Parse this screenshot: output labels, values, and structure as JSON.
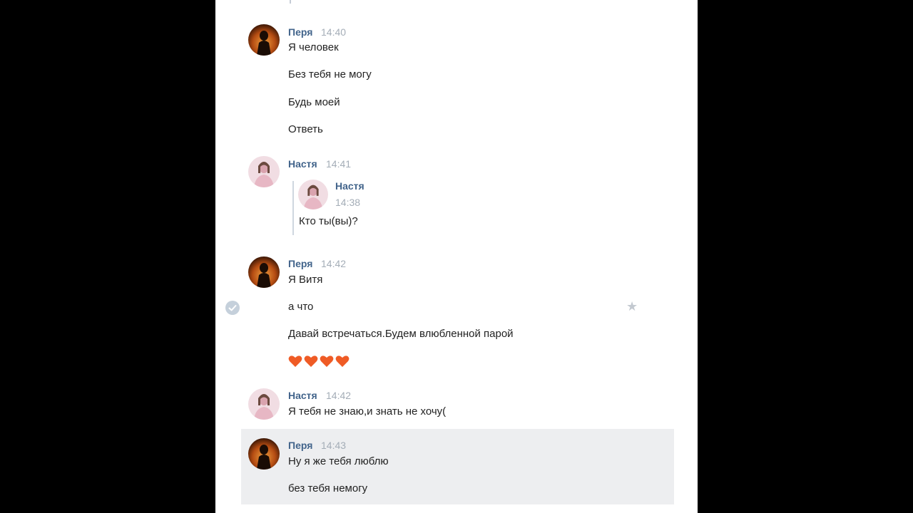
{
  "colors": {
    "name": "#42648b",
    "time": "#a4adb7",
    "text": "#222222",
    "highlight": "#edeef0",
    "heart": "#ef5b25"
  },
  "messages": [
    {
      "author": "Перя",
      "time": "14:40",
      "lines": [
        "Я человек",
        "Без тебя не могу",
        "Будь моей",
        "Ответь"
      ]
    },
    {
      "author": "Настя",
      "time": "14:41",
      "forward": {
        "author": "Настя",
        "time": "14:38",
        "text": "Кто ты(вы)?"
      }
    },
    {
      "author": "Перя",
      "time": "14:42",
      "lines": [
        "Я Витя",
        "а что",
        "Давай встречаться.Будем влюбленной парой"
      ],
      "emoji": [
        "heart-icon",
        "heart-icon",
        "heart-icon",
        "heart-icon"
      ]
    },
    {
      "author": "Настя",
      "time": "14:42",
      "lines": [
        "Я тебя не знаю,и знать не хочу("
      ]
    },
    {
      "author": "Перя",
      "time": "14:43",
      "lines": [
        "Ну я же тебя люблю",
        "без тебя немогу"
      ]
    }
  ],
  "icons": {
    "select": "check-circle-icon",
    "favorite": "star-icon"
  }
}
